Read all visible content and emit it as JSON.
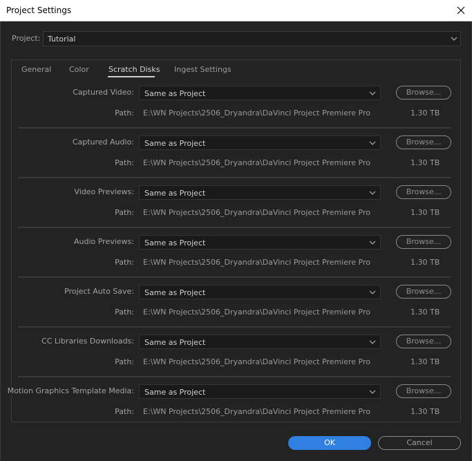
{
  "window": {
    "title": "Project Settings"
  },
  "project": {
    "label": "Project:",
    "value": "Tutorial"
  },
  "tabs": [
    {
      "label": "General"
    },
    {
      "label": "Color"
    },
    {
      "label": "Scratch Disks",
      "active": true
    },
    {
      "label": "Ingest Settings"
    }
  ],
  "scratch_disks": [
    {
      "label": "Captured Video:",
      "value": "Same as Project",
      "browse": "Browse...",
      "path_label": "Path:",
      "path": "E:\\WN Projects\\2506_Dryandra\\DaVinci Project Premiere Pro",
      "size": "1.30 TB"
    },
    {
      "label": "Captured Audio:",
      "value": "Same as Project",
      "browse": "Browse...",
      "path_label": "Path:",
      "path": "E:\\WN Projects\\2506_Dryandra\\DaVinci Project Premiere Pro",
      "size": "1.30 TB"
    },
    {
      "label": "Video Previews:",
      "value": "Same as Project",
      "browse": "Browse...",
      "path_label": "Path:",
      "path": "E:\\WN Projects\\2506_Dryandra\\DaVinci Project Premiere Pro",
      "size": "1.30 TB"
    },
    {
      "label": "Audio Previews:",
      "value": "Same as Project",
      "browse": "Browse...",
      "path_label": "Path:",
      "path": "E:\\WN Projects\\2506_Dryandra\\DaVinci Project Premiere Pro",
      "size": "1.30 TB"
    },
    {
      "label": "Project Auto Save:",
      "value": "Same as Project",
      "browse": "Browse...",
      "path_label": "Path:",
      "path": "E:\\WN Projects\\2506_Dryandra\\DaVinci Project Premiere Pro",
      "size": "1.30 TB"
    },
    {
      "label": "CC Libraries Downloads:",
      "value": "Same as Project",
      "browse": "Browse...",
      "path_label": "Path:",
      "path": "E:\\WN Projects\\2506_Dryandra\\DaVinci Project Premiere Pro",
      "size": "1.30 TB"
    },
    {
      "label": "Motion Graphics Template Media:",
      "value": "Same as Project",
      "browse": "Browse...",
      "path_label": "Path:",
      "path": "E:\\WN Projects\\2506_Dryandra\\DaVinci Project Premiere Pro",
      "size": "1.30 TB"
    }
  ],
  "buttons": {
    "ok": "OK",
    "cancel": "Cancel"
  },
  "colors": {
    "background": "#232323",
    "accent": "#2f80e0",
    "titlebar": "#ffffff"
  },
  "icons": {
    "close": "close-icon",
    "dropdown": "chevron-down-icon"
  }
}
